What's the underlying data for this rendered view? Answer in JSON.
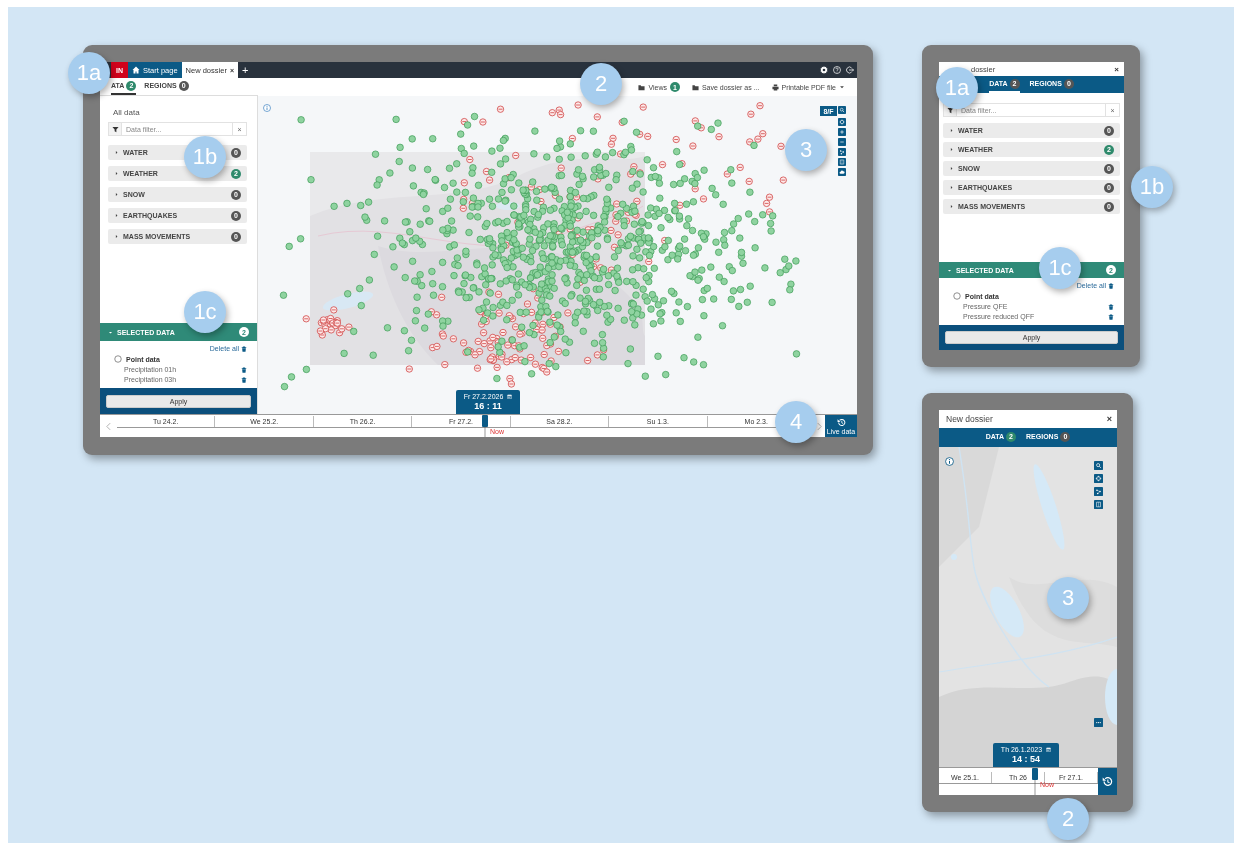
{
  "callouts": [
    {
      "label": "1a"
    },
    {
      "label": "2"
    },
    {
      "label": "3"
    },
    {
      "label": "1b"
    },
    {
      "label": "1c"
    },
    {
      "label": "4"
    },
    {
      "label": "1a"
    },
    {
      "label": "1b"
    },
    {
      "label": "1c"
    },
    {
      "label": "3"
    },
    {
      "label": "2"
    }
  ],
  "desktop": {
    "app_tabs": [
      {
        "label": "IN",
        "kind": "login"
      },
      {
        "label": "Start page",
        "kind": "home"
      },
      {
        "label": "New dossier",
        "kind": "dossier",
        "close": "×"
      }
    ],
    "add_tab": "+",
    "panel_tabs": [
      {
        "label": "ATA",
        "badge": "2",
        "highlight": true,
        "selected": true
      },
      {
        "label": "REGIONS",
        "badge": "0",
        "highlight": false,
        "selected": false
      }
    ],
    "toolbar": [
      {
        "label": "Views",
        "badge": "1",
        "kind": "folder"
      },
      {
        "label": "Save dossier as ...",
        "kind": "folder"
      },
      {
        "label": "Printable PDF file",
        "kind": "print"
      }
    ],
    "sidebar": {
      "heading": "All data",
      "filter": {
        "placeholder": "Data filter...",
        "clear": "×"
      },
      "categories": [
        {
          "label": "WATER",
          "count": "0",
          "highlight": false
        },
        {
          "label": "WEATHER",
          "count": "2",
          "highlight": true
        },
        {
          "label": "SNOW",
          "count": "0",
          "highlight": false
        },
        {
          "label": "EARTHQUAKES",
          "count": "0",
          "highlight": false
        },
        {
          "label": "MASS MOVEMENTS",
          "count": "0",
          "highlight": false
        }
      ],
      "selected_data": {
        "title": "SELECTED DATA",
        "count": "2",
        "delete_all": "Delete all",
        "group": "Point data",
        "checked": false,
        "items": [
          "Precipitation 01h",
          "Precipitation 03h"
        ]
      },
      "apply": "Apply"
    },
    "map": {
      "toggle": "8/F"
    },
    "timeline": {
      "date": "Fr 27.2.2026",
      "time": "16 : 11",
      "now": "Now",
      "days": [
        "Tu 24.2.",
        "We 25.2.",
        "Th 26.2.",
        "Fr 27.2.",
        "Sa 28.2.",
        "Su 1.3.",
        "Mo 2.3."
      ],
      "live": "Live data"
    }
  },
  "tablet": {
    "title": "dossier",
    "close": "×",
    "panel_tabs": [
      {
        "label": "DATA",
        "badge": "2",
        "highlight": false,
        "selected": true
      },
      {
        "label": "REGIONS",
        "badge": "0",
        "highlight": false,
        "selected": false
      }
    ],
    "sidebar": {
      "filter": {
        "placeholder": "Data filter...",
        "clear": "×"
      },
      "categories": [
        {
          "label": "WATER",
          "count": "0",
          "highlight": false
        },
        {
          "label": "WEATHER",
          "count": "2",
          "highlight": true
        },
        {
          "label": "SNOW",
          "count": "0",
          "highlight": false
        },
        {
          "label": "EARTHQUAKES",
          "count": "0",
          "highlight": false
        },
        {
          "label": "MASS MOVEMENTS",
          "count": "0",
          "highlight": false
        }
      ],
      "selected_data": {
        "title": "SELECTED DATA",
        "count": "2",
        "delete_all": "Delete all",
        "group": "Point data",
        "checked": false,
        "items": [
          "Pressure QFE",
          "Pressure reduced QFF"
        ]
      },
      "apply": "Apply"
    }
  },
  "phone": {
    "title": "New dossier",
    "close": "×",
    "panel_tabs": [
      {
        "label": "DATA",
        "badge": "2",
        "highlight": true
      },
      {
        "label": "REGIONS",
        "badge": "0",
        "highlight": false
      }
    ],
    "timeline": {
      "date": "Th 26.1.2023",
      "time": "14 : 54",
      "now": "Now",
      "days": [
        "We 25.1.",
        "Th 26",
        "Fr 27.1."
      ]
    }
  }
}
